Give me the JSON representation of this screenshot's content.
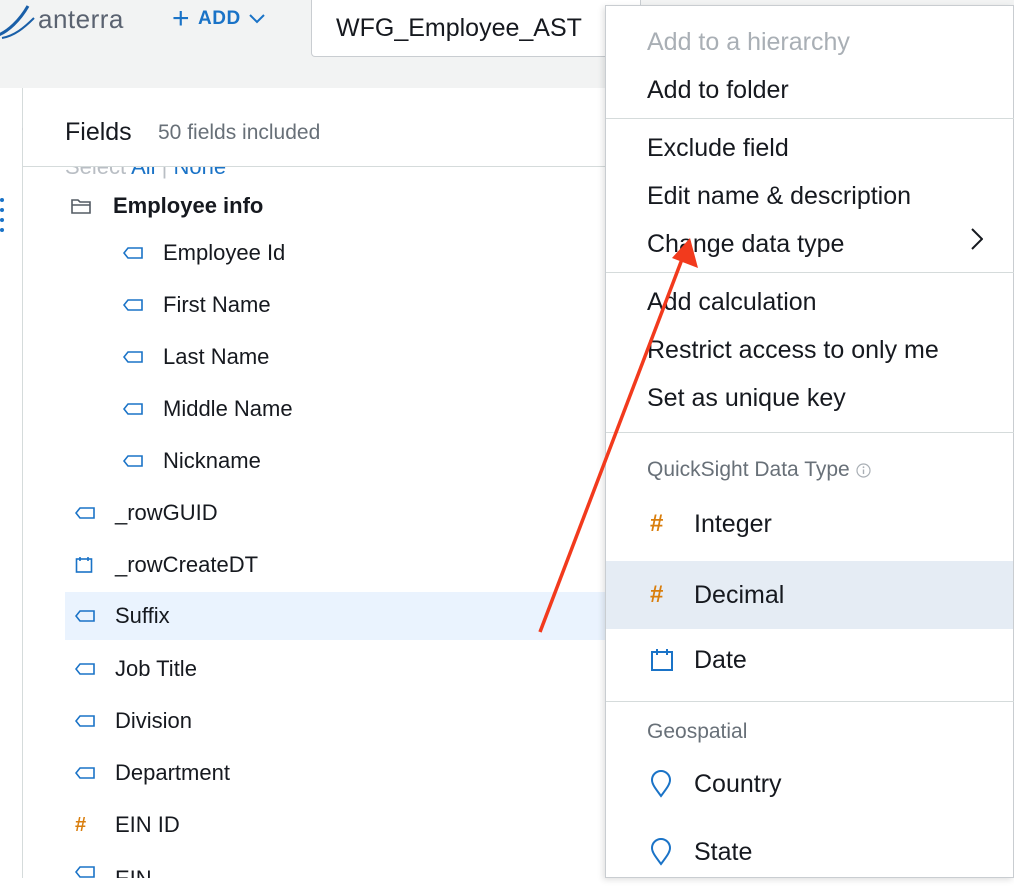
{
  "header": {
    "logo_text": "anterra",
    "add_label": "ADD",
    "dataset_name": "WFG_Employee_AST"
  },
  "fields_panel": {
    "title": "Fields",
    "count_text": "50 fields included",
    "select_label": "Select",
    "select_all": "All",
    "select_none": "None",
    "folder": {
      "label": "Employee info"
    },
    "folder_items": [
      "Employee Id",
      "First Name",
      "Last Name",
      "Middle Name",
      "Nickname"
    ],
    "items": [
      {
        "label": "_rowGUID",
        "type": "string"
      },
      {
        "label": "_rowCreateDT",
        "type": "date"
      },
      {
        "label": "Suffix",
        "type": "string",
        "selected": true
      },
      {
        "label": "Job Title",
        "type": "string"
      },
      {
        "label": "Division",
        "type": "string"
      },
      {
        "label": "Department",
        "type": "string"
      },
      {
        "label": "EIN ID",
        "type": "number"
      },
      {
        "label": "EIN",
        "type": "string"
      }
    ]
  },
  "menu": {
    "add_to_hierarchy": "Add to a hierarchy",
    "add_to_folder": "Add to folder",
    "exclude_field": "Exclude field",
    "edit_name": "Edit name & description",
    "change_data_type": "Change data type",
    "add_calculation": "Add calculation",
    "restrict_access": "Restrict access to only me",
    "set_unique_key": "Set as unique key",
    "data_type_section": "QuickSight Data Type",
    "types": [
      {
        "label": "Integer",
        "icon": "hash-icon"
      },
      {
        "label": "Decimal",
        "icon": "hash-icon",
        "active": true
      },
      {
        "label": "Date",
        "icon": "calendar-icon"
      }
    ],
    "geo_section": "Geospatial",
    "geo_types": [
      {
        "label": "Country",
        "icon": "map-pin-icon"
      },
      {
        "label": "State",
        "icon": "map-pin-icon"
      }
    ]
  },
  "colors": {
    "accent": "#1a73c7",
    "number_icon": "#d97e0d",
    "string_icon": "#1a73c7",
    "annotation_arrow": "#f23a1d",
    "selected_row": "#eaf3fe",
    "active_menu_row": "#e5ecf4"
  }
}
